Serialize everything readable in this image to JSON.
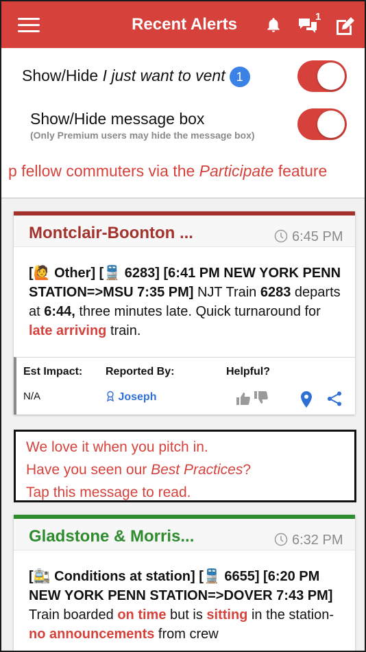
{
  "header": {
    "title": "Recent Alerts",
    "chat_count": "1"
  },
  "toggles": {
    "vent": {
      "label_prefix": "Show/Hide ",
      "label_italic": "I just want to vent",
      "badge": "1"
    },
    "message_box": {
      "label": "Show/Hide message box",
      "sublabel": "(Only Premium users may hide the message box)"
    }
  },
  "marquee": {
    "before": "p fellow commuters via the ",
    "italic": "Participate",
    "after": " feature"
  },
  "cards": [
    {
      "line_name": "Montclair-Boonton ...",
      "time": "6:45 PM",
      "accent": "#a3322d",
      "body": {
        "p1": "[🙋 Other] [🚆 6283] [6:41 PM NEW YORK PENN STATION=>MSU 7:35 PM]",
        "p2": " NJT Train ",
        "p3": "6283",
        "p4": " departs at ",
        "p5": "6:44,",
        "p6": " three minutes late. Quick turnaround for ",
        "p7": "late arriving",
        "p8": " train."
      },
      "footer": {
        "impact_label": "Est Impact:",
        "impact_value": "N/A",
        "reported_label": "Reported By:",
        "reporter": "Joseph",
        "helpful_label": "Helpful?"
      }
    },
    {
      "line_name": "Gladstone & Morris...",
      "time": "6:32 PM",
      "accent": "#2e8b2e",
      "body": {
        "p1": "[🚉 Conditions at station] [🚆 6655] [6:20 PM NEW YORK PENN STATION=>DOVER 7:43 PM]",
        "p2": " Train boarded ",
        "p3": "on time",
        "p4": " but is ",
        "p5": "sitting",
        "p6": " in the station- ",
        "p7": "no announcements",
        "p8": " from crew"
      }
    }
  ],
  "message_box": {
    "line1": "We love it when you pitch in.",
    "line2_prefix": "Have you seen our ",
    "line2_italic": "Best Practices",
    "line2_suffix": "?",
    "line3": "Tap this message to read."
  },
  "colors": {
    "brand_red": "#d6423b",
    "link_blue": "#2f6fd6",
    "toggle_on": "#d6423b"
  }
}
